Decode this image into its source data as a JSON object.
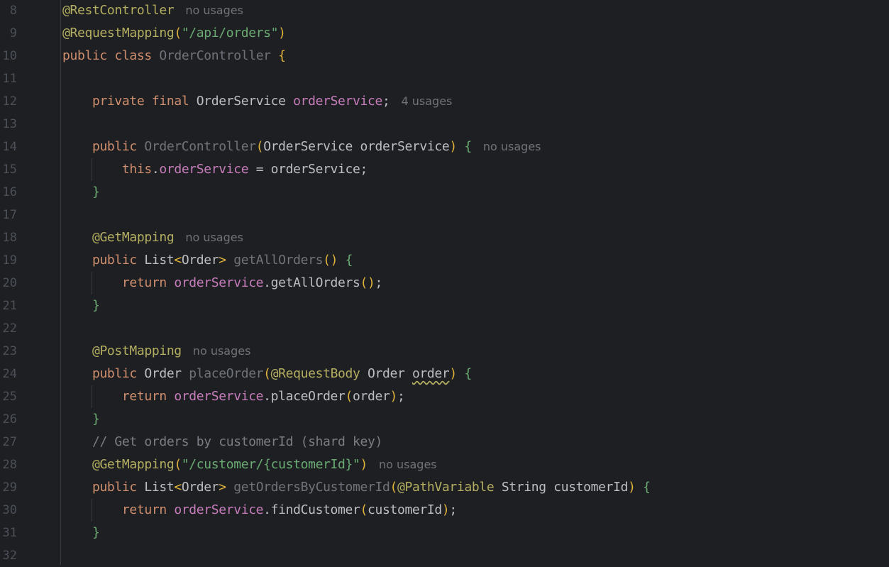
{
  "editor": {
    "lines": [
      {
        "num": "8",
        "tokens": [
          {
            "t": "@RestController",
            "c": "ann"
          }
        ],
        "hint": "no usages"
      },
      {
        "num": "9",
        "tokens": [
          {
            "t": "@RequestMapping",
            "c": "ann"
          },
          {
            "t": "(",
            "c": "paren"
          },
          {
            "t": "\"/api/orders\"",
            "c": "str"
          },
          {
            "t": ")",
            "c": "paren"
          }
        ],
        "hint": ""
      },
      {
        "num": "10",
        "tokens": [
          {
            "t": "public",
            "c": "kw"
          },
          {
            "t": " ",
            "c": "plain"
          },
          {
            "t": "class",
            "c": "kw"
          },
          {
            "t": " ",
            "c": "plain"
          },
          {
            "t": "OrderController",
            "c": "decl"
          },
          {
            "t": " ",
            "c": "plain"
          },
          {
            "t": "{",
            "c": "brace-y"
          }
        ],
        "hint": ""
      },
      {
        "num": "11",
        "tokens": [],
        "hint": ""
      },
      {
        "num": "12",
        "tokens": [
          {
            "t": "    ",
            "c": "plain"
          },
          {
            "t": "private",
            "c": "kw"
          },
          {
            "t": " ",
            "c": "plain"
          },
          {
            "t": "final",
            "c": "kw"
          },
          {
            "t": " OrderService ",
            "c": "plain"
          },
          {
            "t": "orderService",
            "c": "fld"
          },
          {
            "t": ";",
            "c": "plain"
          }
        ],
        "hint": "4 usages"
      },
      {
        "num": "13",
        "tokens": [],
        "hint": ""
      },
      {
        "num": "14",
        "tokens": [
          {
            "t": "    ",
            "c": "plain"
          },
          {
            "t": "public",
            "c": "kw"
          },
          {
            "t": " ",
            "c": "plain"
          },
          {
            "t": "OrderController",
            "c": "decl"
          },
          {
            "t": "(",
            "c": "paren"
          },
          {
            "t": "OrderService orderService",
            "c": "plain"
          },
          {
            "t": ")",
            "c": "paren"
          },
          {
            "t": " ",
            "c": "plain"
          },
          {
            "t": "{",
            "c": "brace"
          }
        ],
        "hint": "no usages"
      },
      {
        "num": "15",
        "tokens": [
          {
            "t": "        ",
            "c": "plain"
          },
          {
            "t": "this",
            "c": "kw"
          },
          {
            "t": ".",
            "c": "plain"
          },
          {
            "t": "orderService",
            "c": "fld"
          },
          {
            "t": " = orderService;",
            "c": "plain"
          }
        ],
        "hint": "",
        "guide": true
      },
      {
        "num": "16",
        "tokens": [
          {
            "t": "    ",
            "c": "plain"
          },
          {
            "t": "}",
            "c": "brace"
          }
        ],
        "hint": ""
      },
      {
        "num": "17",
        "tokens": [],
        "hint": ""
      },
      {
        "num": "18",
        "tokens": [
          {
            "t": "    ",
            "c": "plain"
          },
          {
            "t": "@GetMapping",
            "c": "ann"
          }
        ],
        "hint": "no usages"
      },
      {
        "num": "19",
        "tokens": [
          {
            "t": "    ",
            "c": "plain"
          },
          {
            "t": "public",
            "c": "kw"
          },
          {
            "t": " List",
            "c": "plain"
          },
          {
            "t": "<",
            "c": "paren"
          },
          {
            "t": "Order",
            "c": "plain"
          },
          {
            "t": ">",
            "c": "paren"
          },
          {
            "t": " ",
            "c": "plain"
          },
          {
            "t": "getAllOrders",
            "c": "decl"
          },
          {
            "t": "()",
            "c": "paren"
          },
          {
            "t": " ",
            "c": "plain"
          },
          {
            "t": "{",
            "c": "brace"
          }
        ],
        "hint": ""
      },
      {
        "num": "20",
        "tokens": [
          {
            "t": "        ",
            "c": "plain"
          },
          {
            "t": "return",
            "c": "kw"
          },
          {
            "t": " ",
            "c": "plain"
          },
          {
            "t": "orderService",
            "c": "fld"
          },
          {
            "t": ".getAllOrders",
            "c": "plain"
          },
          {
            "t": "()",
            "c": "paren"
          },
          {
            "t": ";",
            "c": "plain"
          }
        ],
        "hint": "",
        "guide": true
      },
      {
        "num": "21",
        "tokens": [
          {
            "t": "    ",
            "c": "plain"
          },
          {
            "t": "}",
            "c": "brace"
          }
        ],
        "hint": ""
      },
      {
        "num": "22",
        "tokens": [],
        "hint": ""
      },
      {
        "num": "23",
        "tokens": [
          {
            "t": "    ",
            "c": "plain"
          },
          {
            "t": "@PostMapping",
            "c": "ann"
          }
        ],
        "hint": "no usages"
      },
      {
        "num": "24",
        "tokens": [
          {
            "t": "    ",
            "c": "plain"
          },
          {
            "t": "public",
            "c": "kw"
          },
          {
            "t": " Order ",
            "c": "plain"
          },
          {
            "t": "placeOrder",
            "c": "decl"
          },
          {
            "t": "(",
            "c": "paren"
          },
          {
            "t": "@RequestBody",
            "c": "ann"
          },
          {
            "t": " Order ",
            "c": "plain"
          },
          {
            "t": "order",
            "c": "plain warn"
          },
          {
            "t": ")",
            "c": "paren"
          },
          {
            "t": " ",
            "c": "plain"
          },
          {
            "t": "{",
            "c": "brace"
          }
        ],
        "hint": ""
      },
      {
        "num": "25",
        "tokens": [
          {
            "t": "        ",
            "c": "plain"
          },
          {
            "t": "return",
            "c": "kw"
          },
          {
            "t": " ",
            "c": "plain"
          },
          {
            "t": "orderService",
            "c": "fld"
          },
          {
            "t": ".placeOrder",
            "c": "plain"
          },
          {
            "t": "(",
            "c": "paren"
          },
          {
            "t": "order",
            "c": "plain"
          },
          {
            "t": ")",
            "c": "paren"
          },
          {
            "t": ";",
            "c": "plain"
          }
        ],
        "hint": "",
        "guide": true
      },
      {
        "num": "26",
        "tokens": [
          {
            "t": "    ",
            "c": "plain"
          },
          {
            "t": "}",
            "c": "brace"
          }
        ],
        "hint": ""
      },
      {
        "num": "27",
        "tokens": [
          {
            "t": "    ",
            "c": "plain"
          },
          {
            "t": "// Get orders by customerId (shard key)",
            "c": "cmt"
          }
        ],
        "hint": ""
      },
      {
        "num": "28",
        "tokens": [
          {
            "t": "    ",
            "c": "plain"
          },
          {
            "t": "@GetMapping",
            "c": "ann"
          },
          {
            "t": "(",
            "c": "paren"
          },
          {
            "t": "\"/customer/{customerId}\"",
            "c": "str"
          },
          {
            "t": ")",
            "c": "paren"
          }
        ],
        "hint": "no usages"
      },
      {
        "num": "29",
        "tokens": [
          {
            "t": "    ",
            "c": "plain"
          },
          {
            "t": "public",
            "c": "kw"
          },
          {
            "t": " List",
            "c": "plain"
          },
          {
            "t": "<",
            "c": "paren"
          },
          {
            "t": "Order",
            "c": "plain"
          },
          {
            "t": ">",
            "c": "paren"
          },
          {
            "t": " ",
            "c": "plain"
          },
          {
            "t": "getOrdersByCustomerId",
            "c": "decl"
          },
          {
            "t": "(",
            "c": "paren"
          },
          {
            "t": "@PathVariable",
            "c": "ann"
          },
          {
            "t": " String customerId",
            "c": "plain"
          },
          {
            "t": ")",
            "c": "paren"
          },
          {
            "t": " ",
            "c": "plain"
          },
          {
            "t": "{",
            "c": "brace"
          }
        ],
        "hint": ""
      },
      {
        "num": "30",
        "tokens": [
          {
            "t": "        ",
            "c": "plain"
          },
          {
            "t": "return",
            "c": "kw"
          },
          {
            "t": " ",
            "c": "plain"
          },
          {
            "t": "orderService",
            "c": "fld"
          },
          {
            "t": ".findCustomer",
            "c": "plain"
          },
          {
            "t": "(",
            "c": "paren"
          },
          {
            "t": "customerId",
            "c": "plain"
          },
          {
            "t": ")",
            "c": "paren"
          },
          {
            "t": ";",
            "c": "plain"
          }
        ],
        "hint": "",
        "guide": true
      },
      {
        "num": "31",
        "tokens": [
          {
            "t": "    ",
            "c": "plain"
          },
          {
            "t": "}",
            "c": "brace"
          }
        ],
        "hint": ""
      },
      {
        "num": "32",
        "tokens": [],
        "hint": ""
      }
    ]
  }
}
